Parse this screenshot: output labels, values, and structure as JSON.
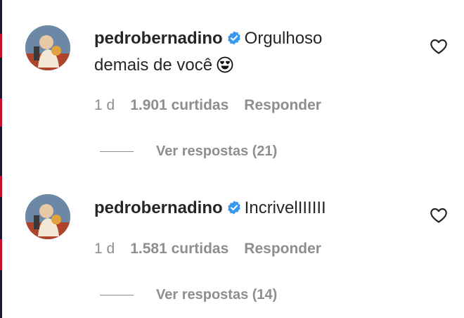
{
  "comments": [
    {
      "username": "pedrobernadino",
      "text_line1": "Orgulhoso",
      "text_line2": "demais de você",
      "emoji_icon": "heart-eyes-emoji",
      "time": "1 d",
      "likes": "1.901 curtidas",
      "reply_label": "Responder",
      "view_replies": "Ver respostas (21)"
    },
    {
      "username": "pedrobernadino",
      "text_line1": "IncrivelIIIIII",
      "time": "1 d",
      "likes": "1.581 curtidas",
      "reply_label": "Responder",
      "view_replies": "Ver respostas (14)"
    }
  ],
  "colors": {
    "verified_badge": "#3897f0",
    "secondary_text": "#8e8e8e",
    "primary_text": "#262626"
  }
}
